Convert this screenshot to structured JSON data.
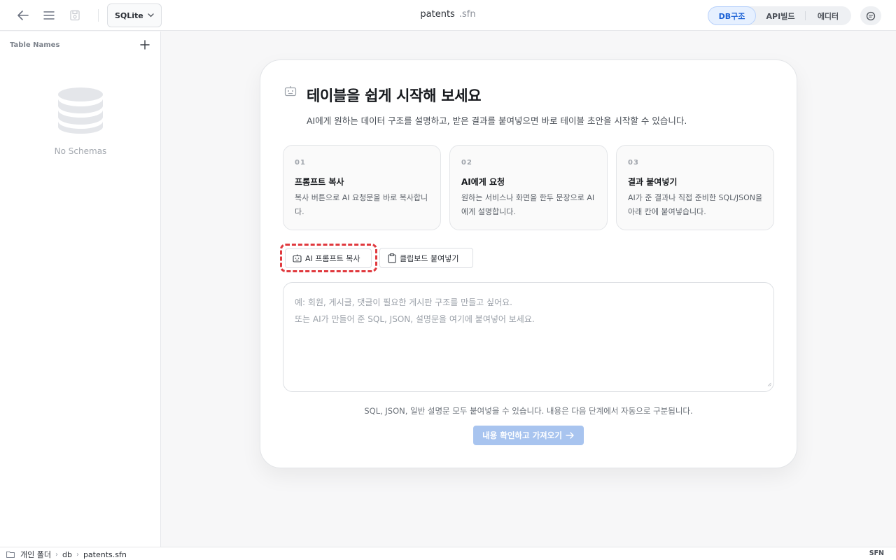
{
  "topbar": {
    "db_engine": "SQLite",
    "file_name": "patents",
    "file_ext": ".sfn",
    "tabs": [
      {
        "label": "DB구조",
        "active": true
      },
      {
        "label": "API빌드",
        "active": false
      },
      {
        "label": "에디터",
        "active": false
      }
    ]
  },
  "sidebar": {
    "title": "Table Names",
    "empty_text": "No Schemas"
  },
  "card": {
    "title": "테이블을 쉽게 시작해 보세요",
    "subtitle": "AI에게 원하는 데이터 구조를 설명하고, 받은 결과를 붙여넣으면 바로 테이블 초안을 시작할 수 있습니다.",
    "steps": [
      {
        "num": "01",
        "title": "프롬프트 복사",
        "desc": "복사 버튼으로 AI 요청문을 바로 복사합니다."
      },
      {
        "num": "02",
        "title": "AI에게 요청",
        "desc": "원하는 서비스나 화면을 한두 문장으로 AI에게 설명합니다."
      },
      {
        "num": "03",
        "title": "결과 붙여넣기",
        "desc": "AI가 준 결과나 직접 준비한 SQL/JSON을 아래 칸에 붙여넣습니다."
      }
    ],
    "copy_button": "AI 프롬프트 복사",
    "paste_button": "클립보드 붙여넣기",
    "placeholder_line1": "예: 회원, 게시글, 댓글이 필요한 게시판 구조를 만들고 싶어요.",
    "placeholder_line2": "또는 AI가 만들어 준 SQL, JSON, 설명문을 여기에 붙여넣어 보세요.",
    "hint": "SQL, JSON, 일반 설명문 모두 붙여넣을 수 있습니다. 내용은 다음 단계에서 자동으로 구분됩니다.",
    "submit": "내용 확인하고 가져오기"
  },
  "statusbar": {
    "crumbs": [
      "개인 폴더",
      "db",
      "patents.sfn"
    ],
    "right": "SFN"
  },
  "colors": {
    "accent": "#1e63d6",
    "highlight": "#e0393e",
    "submit_bg": "#a8c4ef"
  }
}
